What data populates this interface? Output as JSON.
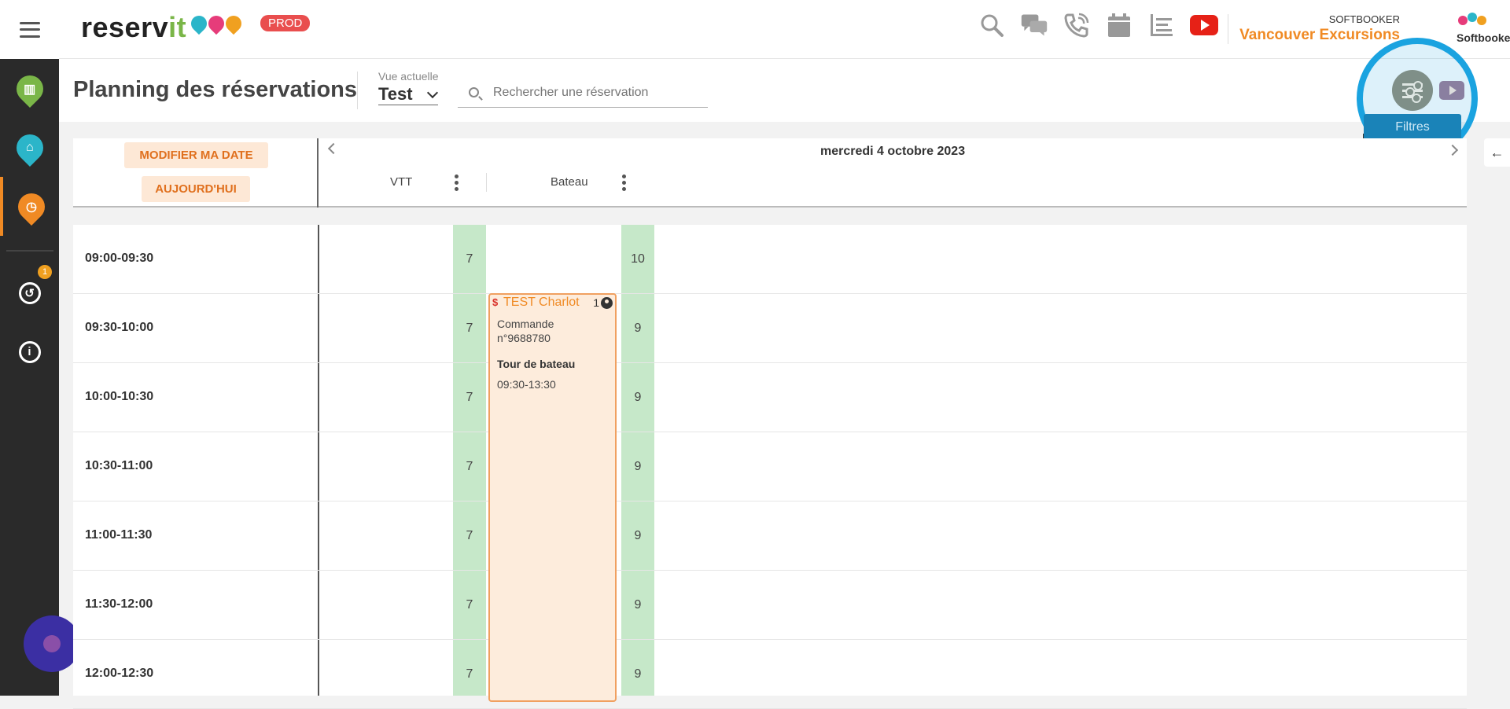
{
  "header": {
    "logo_main": "reserv",
    "logo_accent": "it",
    "env_badge": "PROD",
    "account_small": "SOFTBOOKER",
    "account_name": "Vancouver Excursions",
    "account_logo_text": "Softbooker",
    "icons": [
      "search-icon",
      "chat-icon",
      "phone-icon",
      "calendar-icon",
      "list-icon",
      "youtube-icon"
    ]
  },
  "sidebar": {
    "items": [
      {
        "name": "building-pin-icon",
        "color": "#7ab648"
      },
      {
        "name": "bed-pin-icon",
        "color": "#2bb5c9"
      },
      {
        "name": "clock-pin-icon",
        "color": "#f08a24"
      }
    ],
    "history_badge": "1"
  },
  "subheader": {
    "title": "Planning des réservations",
    "view_label": "Vue actuelle",
    "view_value": "Test",
    "search_placeholder": "Rechercher une réservation",
    "filters_tooltip": "Filtres"
  },
  "calendar": {
    "modify_date_label": "MODIFIER MA DATE",
    "today_label": "AUJOURD'HUI",
    "date_title": "mercredi 4 octobre 2023",
    "resources": [
      "VTT",
      "Bateau"
    ],
    "rows": [
      {
        "time": "09:00-09:30",
        "vtt": "7",
        "bateau": "10"
      },
      {
        "time": "09:30-10:00",
        "vtt": "7",
        "bateau": "9"
      },
      {
        "time": "10:00-10:30",
        "vtt": "7",
        "bateau": "9"
      },
      {
        "time": "10:30-11:00",
        "vtt": "7",
        "bateau": "9"
      },
      {
        "time": "11:00-11:30",
        "vtt": "7",
        "bateau": "9"
      },
      {
        "time": "11:30-12:00",
        "vtt": "7",
        "bateau": "9"
      },
      {
        "time": "12:00-12:30",
        "vtt": "7",
        "bateau": "9"
      }
    ]
  },
  "booking": {
    "currency_symbol": "$",
    "name": "TEST Charlot",
    "participants": "1",
    "order": "Commande n°9688780",
    "activity": "Tour de bateau",
    "hours": "09:30-13:30"
  },
  "colors": {
    "accent_orange": "#f08a24",
    "highlight_blue": "#1aa3e0",
    "availability_green": "#c6e8c9"
  }
}
